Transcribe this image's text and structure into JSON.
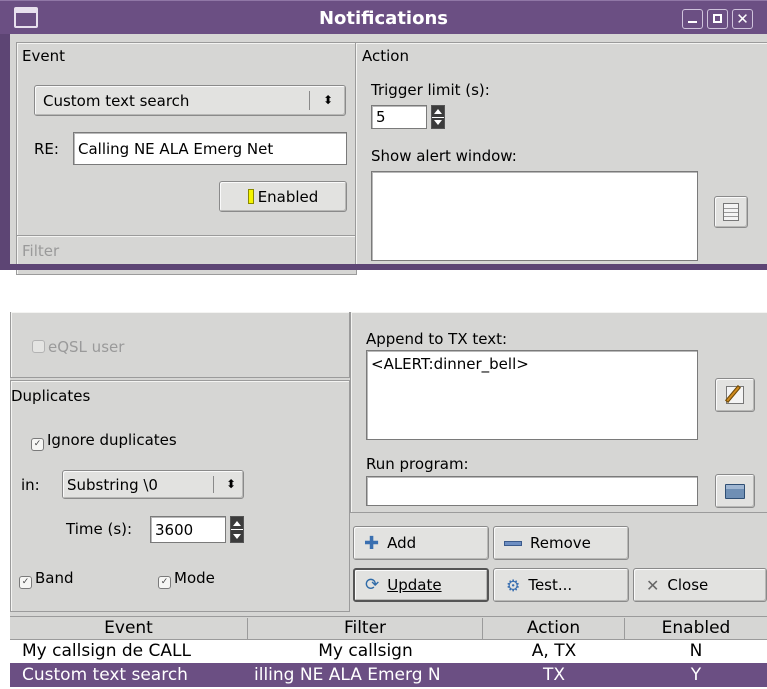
{
  "window": {
    "title": "Notifications"
  },
  "event_group": {
    "title": "Event",
    "type_select": "Custom text search",
    "re_label": "RE:",
    "re_value": "Calling NE ALA Emerg Net",
    "enabled_label": "Enabled"
  },
  "action_group": {
    "title": "Action",
    "trigger_limit_label": "Trigger limit (s):",
    "trigger_limit_value": "5",
    "show_alert_label": "Show alert window:",
    "append_label": "Append to TX text:",
    "append_value": "<ALERT:dinner_bell>",
    "run_program_label": "Run program:",
    "run_program_value": ""
  },
  "filter_group": {
    "title": "Filter",
    "eqsl_label": "eQSL user"
  },
  "duplicates_group": {
    "title": "Duplicates",
    "ignore_label": "Ignore duplicates",
    "in_label": "in:",
    "in_select": "Substring \\0",
    "time_label": "Time (s):",
    "time_value": "3600",
    "band_label": "Band",
    "mode_label": "Mode"
  },
  "buttons": {
    "add": "Add",
    "remove": "Remove",
    "update": "Update",
    "test": "Test...",
    "close": "Close"
  },
  "table": {
    "headers": [
      "Event",
      "Filter",
      "Action",
      "Enabled"
    ],
    "rows": [
      [
        "My callsign de CALL",
        "My callsign",
        "A, TX",
        "N"
      ],
      [
        "Custom text search",
        "illing NE ALA Emerg N",
        "TX",
        "Y"
      ]
    ]
  },
  "colors": {
    "titlebar": "#6b4f83",
    "selected_row": "#6b4f83",
    "enabled_indicator": "#f5f500"
  }
}
